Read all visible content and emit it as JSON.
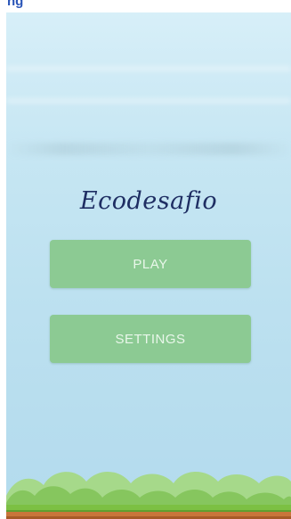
{
  "header": {
    "partial_text": "ng"
  },
  "game": {
    "title": "Ecodesafio"
  },
  "menu": {
    "play_label": "PLAY",
    "settings_label": "SETTINGS"
  },
  "colors": {
    "sky_top": "#d7eff8",
    "sky_bottom": "#b3dbed",
    "button": "#8cca93",
    "button_text": "#e9f7ea",
    "title": "#1f2e63",
    "grass": "#7cc043",
    "soil": "#c8753a"
  }
}
